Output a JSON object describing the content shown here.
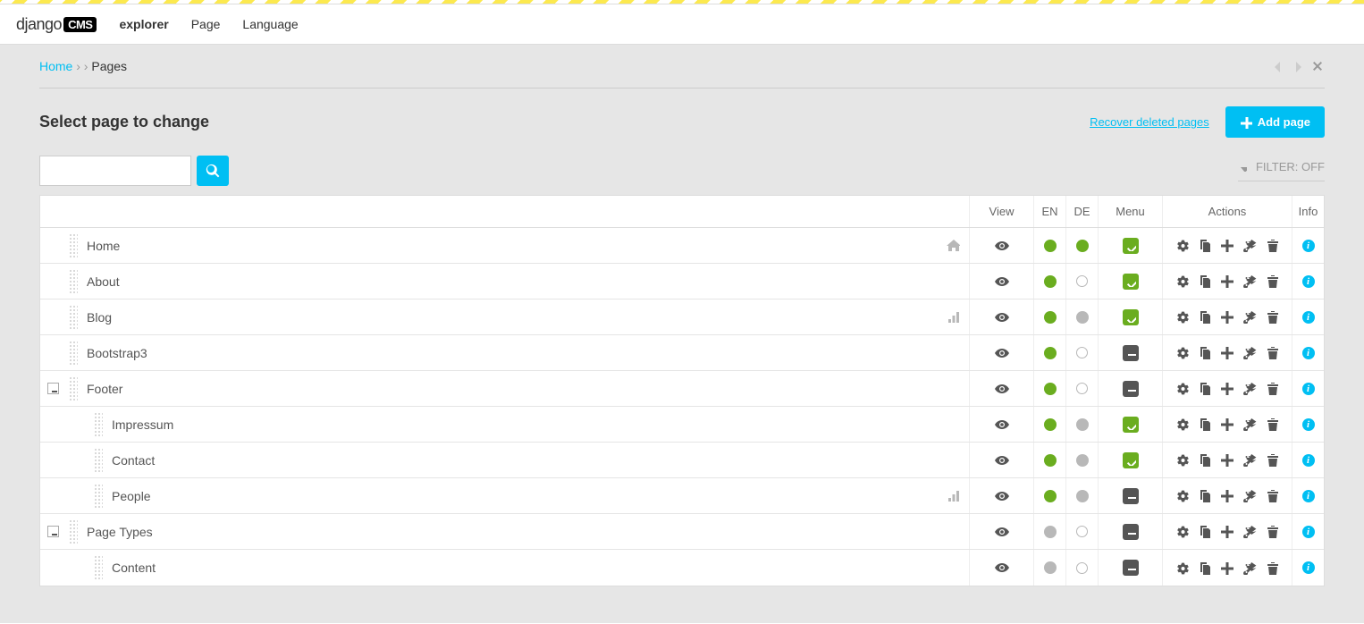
{
  "logo": {
    "text": "django",
    "badge": "CMS"
  },
  "toolbar": {
    "items": [
      {
        "label": "explorer",
        "active": true
      },
      {
        "label": "Page"
      },
      {
        "label": "Language"
      }
    ]
  },
  "breadcrumb": {
    "home": "Home",
    "sep": "› ›",
    "current": "Pages"
  },
  "page_title": "Select page to change",
  "recover_label": "Recover deleted pages",
  "add_label": "Add page",
  "search": {
    "value": "",
    "placeholder": ""
  },
  "filter_label": "FILTER: OFF",
  "columns": {
    "view": "View",
    "en": "EN",
    "de": "DE",
    "menu": "Menu",
    "actions": "Actions",
    "info": "Info"
  },
  "rows": [
    {
      "level": 0,
      "collapse": null,
      "title": "Home",
      "home": true,
      "app": false,
      "en": "green",
      "de": "green",
      "menu": "on"
    },
    {
      "level": 0,
      "collapse": null,
      "title": "About",
      "home": false,
      "app": false,
      "en": "green",
      "de": "empty",
      "menu": "on"
    },
    {
      "level": 0,
      "collapse": null,
      "title": "Blog",
      "home": false,
      "app": true,
      "en": "green",
      "de": "grey",
      "menu": "on"
    },
    {
      "level": 0,
      "collapse": null,
      "title": "Bootstrap3",
      "home": false,
      "app": false,
      "en": "green",
      "de": "empty",
      "menu": "off"
    },
    {
      "level": 0,
      "collapse": "open",
      "title": "Footer",
      "home": false,
      "app": false,
      "en": "green",
      "de": "empty",
      "menu": "off"
    },
    {
      "level": 1,
      "collapse": null,
      "title": "Impressum",
      "home": false,
      "app": false,
      "en": "green",
      "de": "grey",
      "menu": "on"
    },
    {
      "level": 1,
      "collapse": null,
      "title": "Contact",
      "home": false,
      "app": false,
      "en": "green",
      "de": "grey",
      "menu": "on"
    },
    {
      "level": 1,
      "collapse": null,
      "title": "People",
      "home": false,
      "app": true,
      "en": "green",
      "de": "grey",
      "menu": "off"
    },
    {
      "level": 0,
      "collapse": "open",
      "title": "Page Types",
      "home": false,
      "app": false,
      "en": "grey",
      "de": "empty",
      "menu": "off"
    },
    {
      "level": 1,
      "collapse": null,
      "title": "Content",
      "home": false,
      "app": false,
      "en": "grey",
      "de": "empty",
      "menu": "off"
    }
  ]
}
